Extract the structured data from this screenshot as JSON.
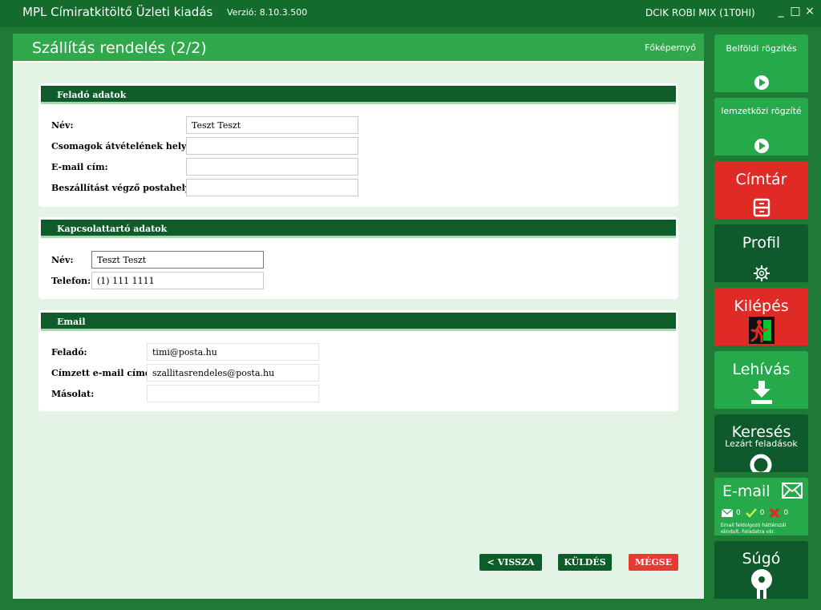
{
  "window": {
    "app_title": "MPL Címiratkitöltő Üzleti kiadás",
    "version": "Verzió: 8.10.3.500",
    "user": "DCIK ROBI MIX (1T0HI)",
    "minimize": "_",
    "maximize": "□",
    "close": "×"
  },
  "page": {
    "title": "Szállítás rendelés (2/2)",
    "home_link": "Főképernyő"
  },
  "sender": {
    "header": "Feladó adatok",
    "name_label": "Név:",
    "name_value": "Teszt Teszt",
    "pickup_label": "Csomagok átvételének helye:",
    "pickup_value": "",
    "email_label": "E-mail cím:",
    "email_value": "",
    "post_label": "Beszállítást végző postahely:",
    "post_value": ""
  },
  "contact": {
    "header": "Kapcsolattartó adatok",
    "name_label": "Név:",
    "name_value": "Teszt Teszt",
    "phone_label": "Telefon:",
    "phone_value": "(1) 111 1111"
  },
  "email": {
    "header": "Email",
    "from_label": "Feladó:",
    "from_value": "timi@posta.hu",
    "to_label": "Címzett e-mail címe:",
    "to_value": "szallitasrendeles@posta.hu",
    "cc_label": "Másolat:",
    "cc_value": ""
  },
  "actions": {
    "back": "< VISSZA",
    "send": "KÜLDÉS",
    "cancel": "MÉGSE"
  },
  "sidebar": {
    "domestic": "Belföldi rögzítés",
    "international": "lemzetközi rögzíté",
    "address_book": "Címtár",
    "profile": "Profil",
    "logout": "Kilépés",
    "pickup": "Lehívás",
    "search": "Keresés",
    "search_sub": "Lezárt feladások",
    "email": "E-mail",
    "email_count_mail": "0",
    "email_count_ok": "0",
    "email_count_err": "0",
    "email_note": "Email feldolgozó háttérszál elindult. Feladatra vár.",
    "help": "Súgó"
  },
  "colors": {
    "brand_green": "#2fa94c",
    "dark_green": "#0d5c2a",
    "alert_red": "#e02a25",
    "panel_bg": "#e3f3e6"
  }
}
